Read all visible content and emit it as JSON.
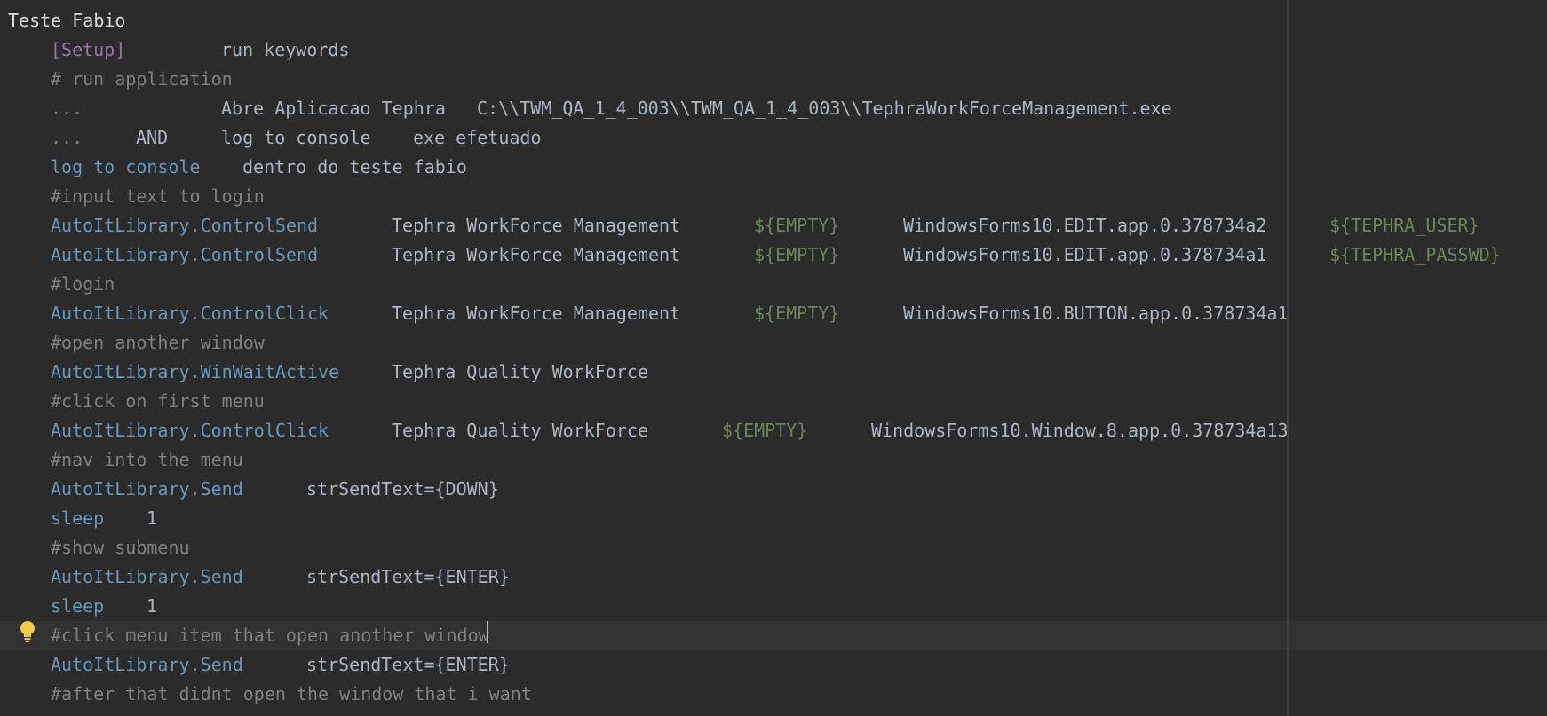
{
  "editor": {
    "lines": [
      [
        {
          "t": "Teste Fabio",
          "c": "title"
        }
      ],
      [
        {
          "t": "[Setup]",
          "c": "setting"
        },
        {
          "t": "run keywords",
          "c": "plain"
        }
      ],
      [
        {
          "t": "# run application",
          "c": "cm"
        }
      ],
      [
        {
          "t": "...",
          "c": "cm"
        },
        {
          "t": "Abre Aplicacao Tephra",
          "c": "plain"
        },
        {
          "t": "C:\\\\TWM_QA_1_4_003\\\\TWM_QA_1_4_003\\\\TephraWorkForceManagement.exe",
          "c": "plain"
        }
      ],
      [
        {
          "t": "...",
          "c": "cm"
        },
        {
          "t": "AND",
          "c": "plain"
        },
        {
          "t": "log to console",
          "c": "plain"
        },
        {
          "t": "exe efetuado",
          "c": "plain"
        }
      ],
      [
        {
          "t": "log to console",
          "c": "kw"
        },
        {
          "t": "dentro do teste fabio",
          "c": "plain"
        }
      ],
      [
        {
          "t": "#input text to login",
          "c": "cm"
        }
      ],
      [
        {
          "t": "AutoItLibrary.ControlSend",
          "c": "kw"
        },
        {
          "t": "Tephra WorkForce Management",
          "c": "plain"
        },
        {
          "t": "${EMPTY}",
          "c": "var"
        },
        {
          "t": "WindowsForms10.EDIT.app.0.378734a2",
          "c": "plain"
        },
        {
          "t": "${TEPHRA_USER}",
          "c": "var"
        }
      ],
      [
        {
          "t": "AutoItLibrary.ControlSend",
          "c": "kw"
        },
        {
          "t": "Tephra WorkForce Management",
          "c": "plain"
        },
        {
          "t": "${EMPTY}",
          "c": "var"
        },
        {
          "t": "WindowsForms10.EDIT.app.0.378734a1",
          "c": "plain"
        },
        {
          "t": "${TEPHRA_PASSWD}",
          "c": "var"
        }
      ],
      [
        {
          "t": "#login",
          "c": "cm"
        }
      ],
      [
        {
          "t": "AutoItLibrary.ControlClick",
          "c": "kw"
        },
        {
          "t": "Tephra WorkForce Management",
          "c": "plain"
        },
        {
          "t": "${EMPTY}",
          "c": "var"
        },
        {
          "t": "WindowsForms10.BUTTON.app.0.378734a1",
          "c": "plain"
        }
      ],
      [
        {
          "t": "#open another window",
          "c": "cm"
        }
      ],
      [
        {
          "t": "AutoItLibrary.WinWaitActive",
          "c": "kw"
        },
        {
          "t": "Tephra Quality WorkForce",
          "c": "plain"
        }
      ],
      [
        {
          "t": "#click on first menu",
          "c": "cm"
        }
      ],
      [
        {
          "t": "AutoItLibrary.ControlClick",
          "c": "kw"
        },
        {
          "t": "Tephra Quality WorkForce",
          "c": "plain"
        },
        {
          "t": "${EMPTY}",
          "c": "var"
        },
        {
          "t": "WindowsForms10.Window.8.app.0.378734a13",
          "c": "plain"
        }
      ],
      [
        {
          "t": "#nav into the menu",
          "c": "cm"
        }
      ],
      [
        {
          "t": "AutoItLibrary.Send",
          "c": "kw"
        },
        {
          "t": "strSendText={DOWN}",
          "c": "plain"
        }
      ],
      [
        {
          "t": "sleep",
          "c": "kw"
        },
        {
          "t": "1",
          "c": "plain"
        }
      ],
      [
        {
          "t": "#show submenu",
          "c": "cm"
        }
      ],
      [
        {
          "t": "AutoItLibrary.Send",
          "c": "kw"
        },
        {
          "t": "strSendText={ENTER}",
          "c": "plain"
        }
      ],
      [
        {
          "t": "sleep",
          "c": "kw"
        },
        {
          "t": "1",
          "c": "plain"
        }
      ],
      [
        {
          "t": "#click menu item that open another window",
          "c": "cm"
        }
      ],
      [
        {
          "t": "AutoItLibrary.Send",
          "c": "kw"
        },
        {
          "t": "strSendText={ENTER}",
          "c": "plain"
        }
      ],
      [
        {
          "t": "#after that didnt open the window that i want",
          "c": "cm"
        }
      ]
    ],
    "current_line_index": 21,
    "intention_icon": "lightbulb-icon",
    "colors": {
      "background": "#2b2b2b",
      "current_line": "#323232",
      "keyword": "#6897bb",
      "comment": "#808080",
      "setting": "#9876aa",
      "variable": "#6a8759",
      "text": "#a9b7c6",
      "bulb": "#f2c94c"
    }
  }
}
